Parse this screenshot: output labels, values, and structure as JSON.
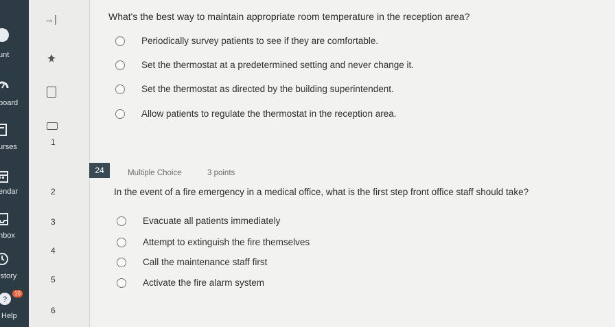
{
  "nav": {
    "items": [
      {
        "label": "unt"
      },
      {
        "label": "board"
      },
      {
        "label": "urses"
      },
      {
        "label": "endar"
      },
      {
        "label": "nbox"
      },
      {
        "label": "istory"
      },
      {
        "label": "Help"
      }
    ],
    "accent_color": "#2d3b45",
    "notification_badge": "10"
  },
  "question_nav": {
    "collapse_icon": "→|",
    "pin_icon": "pin",
    "numbers": [
      "1",
      "2",
      "3",
      "4",
      "5",
      "6"
    ]
  },
  "q23": {
    "text": "What's the best way to maintain appropriate room temperature in the reception area?",
    "options": [
      "Periodically survey patients to see if they are comfortable.",
      "Set the thermostat at a predetermined setting and never change it.",
      "Set the thermostat as directed by the building superintendent.",
      "Allow patients to regulate the thermostat in the reception area."
    ]
  },
  "q24": {
    "number": "24",
    "type": "Multiple Choice",
    "points": "3 points",
    "text": "In the event of a fire emergency in a medical office, what is the first step front office staff should take?",
    "options": [
      "Evacuate all patients immediately",
      "Attempt to extinguish the fire themselves",
      "Call the maintenance staff first",
      "Activate the fire alarm system"
    ]
  }
}
